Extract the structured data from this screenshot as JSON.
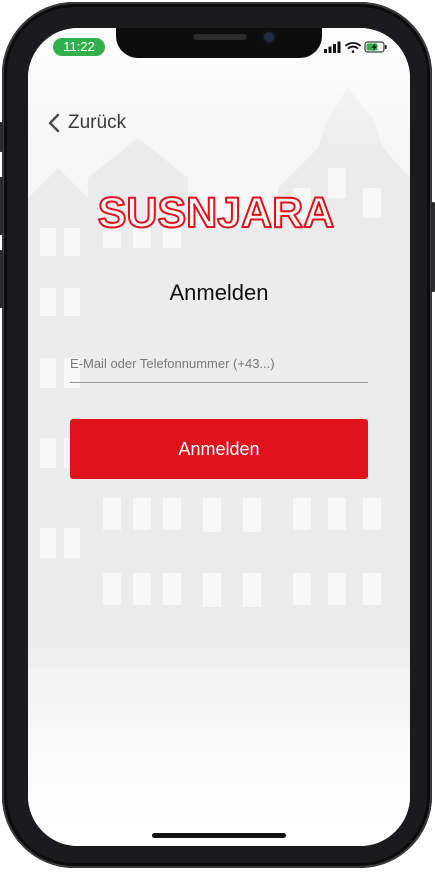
{
  "status_bar": {
    "time": "11:22"
  },
  "nav": {
    "back_label": "Zurück"
  },
  "brand": {
    "logo_text": "SUSNJARA"
  },
  "login": {
    "title": "Anmelden",
    "identifier_placeholder": "E-Mail oder Telefonnummer (+43...)",
    "identifier_value": "",
    "submit_label": "Anmelden"
  },
  "colors": {
    "brand_red": "#e0121c",
    "status_green": "#31b14c",
    "background": "#f3f3f3"
  },
  "icons": [
    "chevron-left-icon",
    "signal-icon",
    "wifi-icon",
    "battery-charging-icon",
    "front-camera-icon"
  ]
}
